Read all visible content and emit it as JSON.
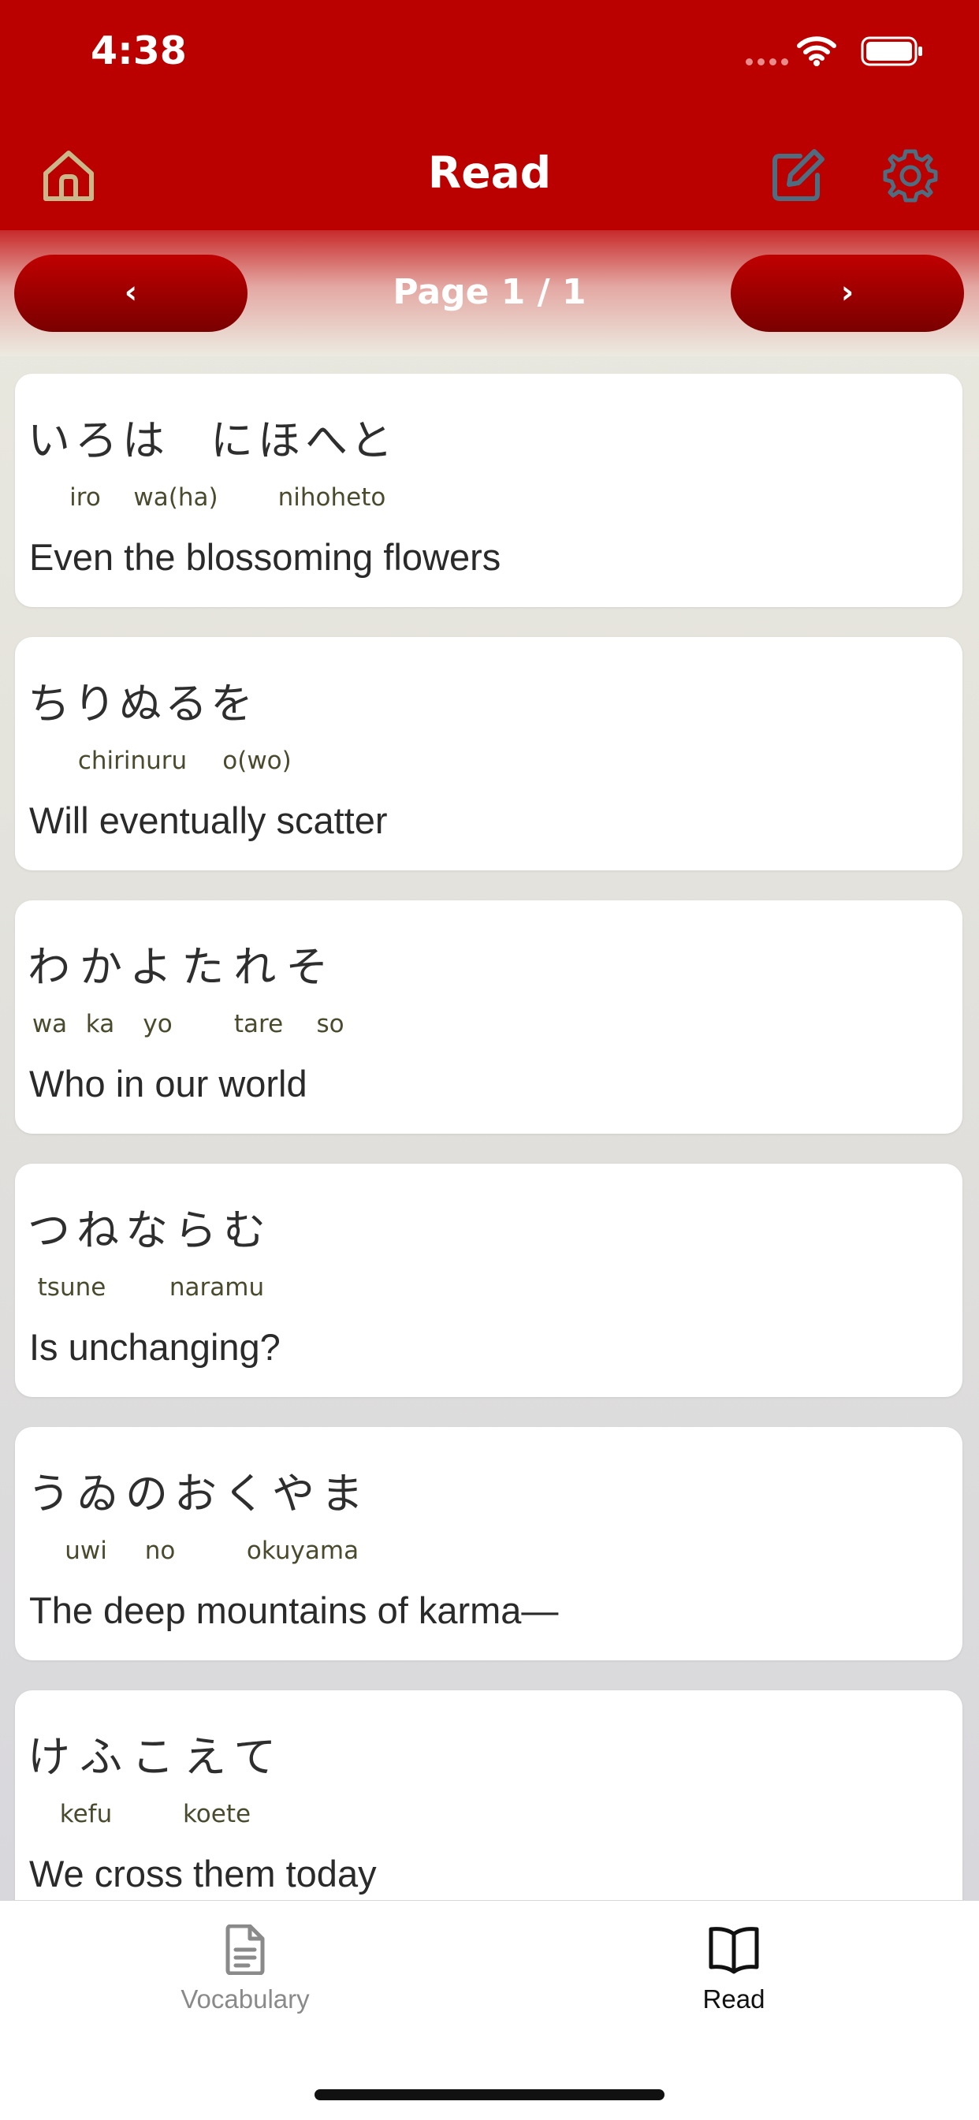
{
  "status_bar": {
    "time": "4:38"
  },
  "nav": {
    "title": "Read"
  },
  "pager": {
    "prev_label": "‹",
    "next_label": "›",
    "page_label": "Page 1 / 1"
  },
  "cards": [
    {
      "words": [
        {
          "jp": "いろは",
          "romaji": [
            "iro",
            "wa(ha)"
          ]
        },
        {
          "jp": "にほへと",
          "romaji": [
            "nihoheto"
          ]
        }
      ],
      "translation": "Even the blossoming flowers"
    },
    {
      "words": [
        {
          "jp": "ちりぬるを",
          "romaji": [
            "chirinuru",
            "o(wo)"
          ]
        }
      ],
      "translation": "Will eventually scatter"
    },
    {
      "words": [
        {
          "jp": "わかよたれそ",
          "romaji": [
            "wa",
            "ka",
            "yo",
            "tare",
            "so"
          ]
        }
      ],
      "translation": "Who in our world"
    },
    {
      "words": [
        {
          "jp": "つねならむ",
          "romaji": [
            "tsune",
            "naramu"
          ]
        }
      ],
      "translation": "Is unchanging?"
    },
    {
      "words": [
        {
          "jp": "うゐのおくやま",
          "romaji": [
            "uwi",
            "no",
            "okuyama"
          ]
        }
      ],
      "translation": "The deep mountains of karma—"
    },
    {
      "words": [
        {
          "jp": "けふこえて",
          "romaji": [
            "kefu",
            "koete"
          ]
        }
      ],
      "translation": "We cross them today"
    }
  ],
  "tabbar": {
    "tabs": [
      {
        "label": "Vocabulary",
        "icon": "document-icon",
        "active": false
      },
      {
        "label": "Read",
        "icon": "book-icon",
        "active": true
      }
    ]
  },
  "colors": {
    "brand_red": "#bb0000",
    "active_tab": "#111111",
    "inactive_tab": "#8a8a8a"
  }
}
